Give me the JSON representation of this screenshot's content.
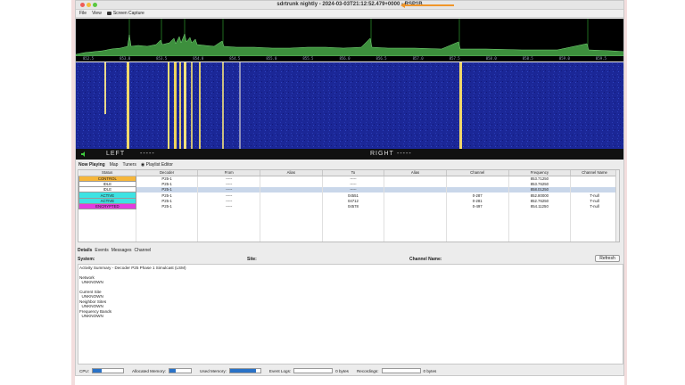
{
  "window": {
    "title": "sdrtrunk nightly - 2024-03-03T21:12:52.479+0000 - RSP1B"
  },
  "menu": {
    "file": "File",
    "view": "View",
    "screen_capture": "Screen Capture"
  },
  "spectrum": {
    "freq_ticks": [
      "852.5",
      "853.0",
      "853.5",
      "854.0",
      "854.5",
      "855.0",
      "855.5",
      "856.0",
      "856.5",
      "857.0",
      "857.5",
      "858.0",
      "858.5",
      "859.0",
      "859.5"
    ]
  },
  "audio": {
    "left_label": "LEFT",
    "left_value": "-----",
    "right_label": "RIGHT",
    "right_value": "-----"
  },
  "tabs_top": {
    "now_playing": "Now Playing",
    "map": "Map",
    "tuners": "Tuners",
    "playlist_editor": "Playlist Editor"
  },
  "calls_table": {
    "headers": [
      "Status",
      "Decoder",
      "From",
      "Alias",
      "To",
      "Alias",
      "Channel",
      "Frequency",
      "Channel Name"
    ],
    "rows": [
      {
        "status": "CONTROL",
        "decoder": "P25-1",
        "from": "-----",
        "alias_from": "",
        "to": "-----",
        "alias_to": "",
        "channel": "",
        "frequency": "853.71250",
        "channel_name": ""
      },
      {
        "status": "IDLE",
        "decoder": "P25-1",
        "from": "-----",
        "alias_from": "",
        "to": "-----",
        "alias_to": "",
        "channel": "",
        "frequency": "853.76250",
        "channel_name": ""
      },
      {
        "status": "IDLE",
        "decoder": "P25-1",
        "from": "-----",
        "alias_from": "",
        "to": "-----",
        "alias_to": "",
        "channel": "",
        "frequency": "858.01250",
        "channel_name": ""
      },
      {
        "status": "ACTIVE",
        "decoder": "P25-1",
        "from": "-----",
        "alias_from": "",
        "to": "04551",
        "alias_to": "",
        "channel": "0-287",
        "frequency": "852.80000",
        "channel_name": "T-null"
      },
      {
        "status": "ACTIVE",
        "decoder": "P25-1",
        "from": "-----",
        "alias_from": "",
        "to": "04712",
        "alias_to": "",
        "channel": "0-281",
        "frequency": "852.76250",
        "channel_name": "T-null"
      },
      {
        "status": "ENCRYPTED",
        "decoder": "P25-1",
        "from": "-----",
        "alias_from": "",
        "to": "04578",
        "alias_to": "",
        "channel": "0-497",
        "frequency": "854.11250",
        "channel_name": "T-null"
      }
    ],
    "status_colors": {
      "CONTROL": "#f6b63a",
      "IDLE": "#ffffff",
      "ACTIVE": "#3de3e3",
      "ENCRYPTED": "#e23ce0"
    }
  },
  "tabs_bottom": {
    "details": "Details",
    "events": "Events",
    "messages": "Messages",
    "channel": "Channel"
  },
  "details": {
    "system_label": "System:",
    "site_label": "Site:",
    "channel_name_label": "Channel Name:",
    "refresh_label": "Refresh",
    "body": "Activity Summary - Decoder P25 Phase 1 Simulcast (LSM)\n\nNetwork\n  UNKNOWN\n\nCurrent Site\n  UNKNOWN\nNeighbor Sites\n  UNKNOWN\nFrequency Bands\n  UNKNOWN"
  },
  "statusbar": {
    "cpu_label": "CPU:",
    "cpu_fill": 0.3,
    "allocated_label": "Allocated Memory:",
    "allocated_fill": 0.3,
    "used_label": "Used Memory:",
    "used_fill": 0.85,
    "event_logs_label": "Event Logs:",
    "event_logs_value": "0 bytes",
    "recordings_label": "Recordings:",
    "recordings_value": "0 bytes"
  }
}
